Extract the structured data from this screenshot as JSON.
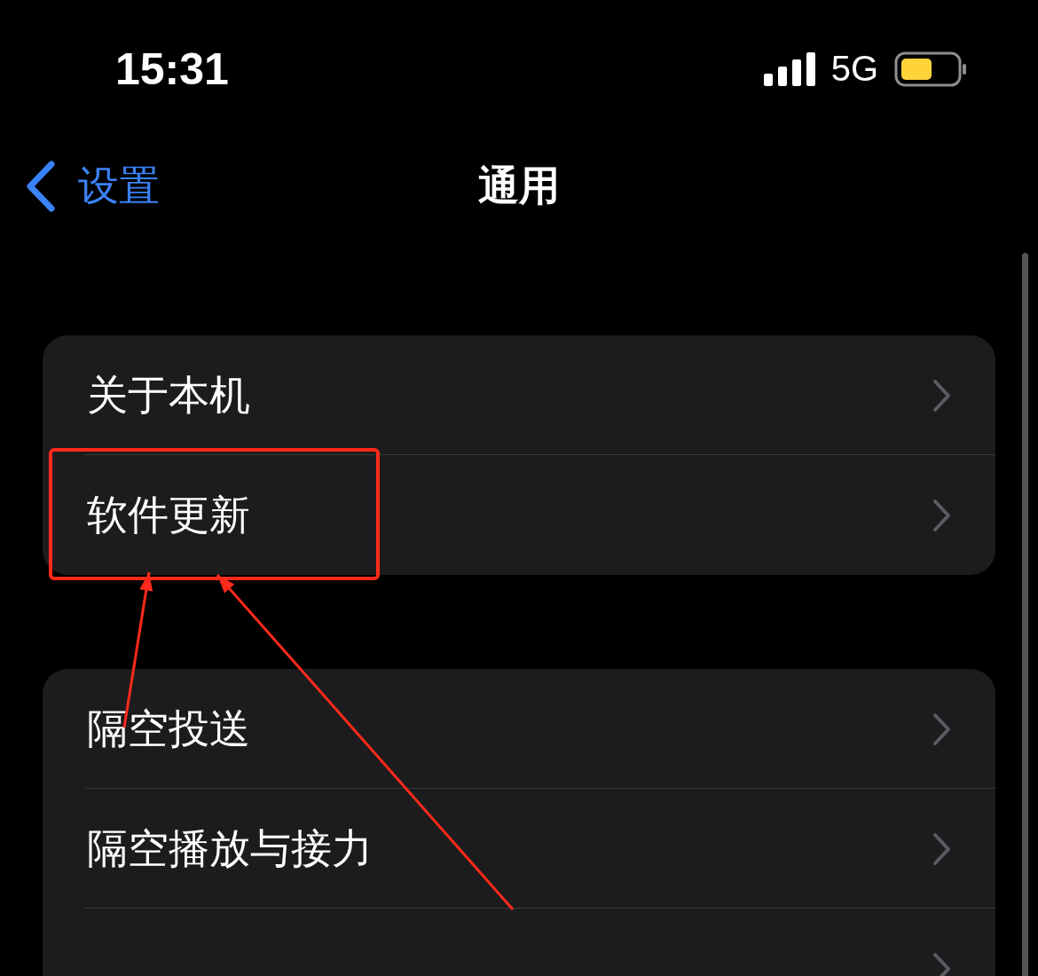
{
  "status_bar": {
    "time": "15:31",
    "network": "5G"
  },
  "nav": {
    "back": "设置",
    "title": "通用"
  },
  "groups": [
    {
      "items": [
        {
          "label": "关于本机",
          "highlighted": false
        },
        {
          "label": "软件更新",
          "highlighted": true
        }
      ]
    },
    {
      "items": [
        {
          "label": "隔空投送",
          "highlighted": false
        },
        {
          "label": "隔空播放与接力",
          "highlighted": false
        },
        {
          "highlighted": false
        }
      ]
    }
  ],
  "annotations": [
    {
      "kind": "arrow"
    },
    {
      "kind": "arrow"
    }
  ]
}
